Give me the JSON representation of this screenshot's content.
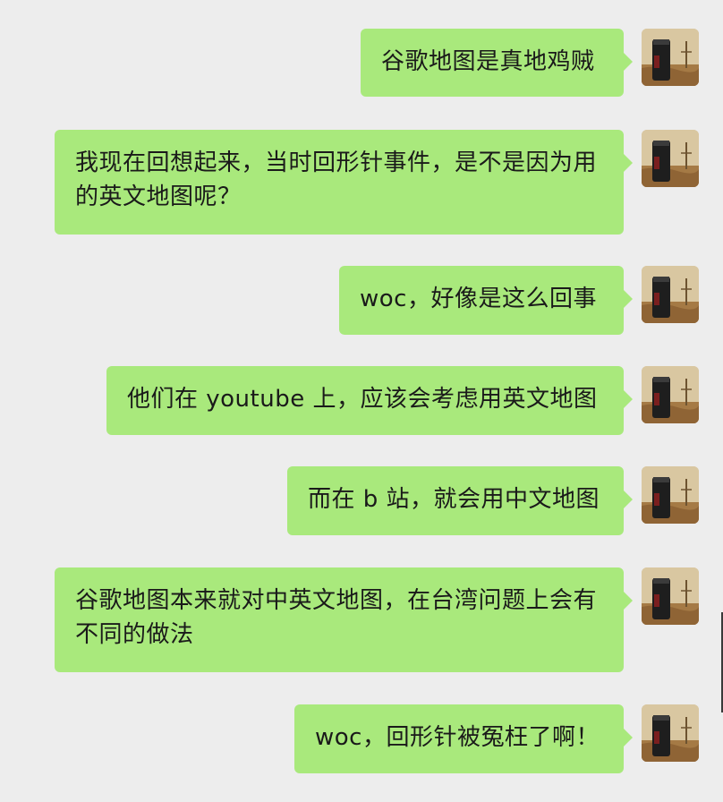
{
  "conversation": {
    "messages": [
      {
        "text": "谷歌地图是真地鸡贼"
      },
      {
        "text": "我现在回想起来，当时回形针事件，是不是因为用的英文地图呢？"
      },
      {
        "text": "woc，好像是这么回事"
      },
      {
        "text": "他们在 youtube 上，应该会考虑用英文地图"
      },
      {
        "text": "而在 b 站，就会用中文地图"
      },
      {
        "text": "谷歌地图本来就对中英文地图，在台湾问题上会有不同的做法"
      },
      {
        "text": "woc，回形针被冤枉了啊！"
      }
    ]
  },
  "colors": {
    "background": "#ededed",
    "bubble": "#a9e97c",
    "text": "#1a1a1a"
  },
  "icons": {
    "avatar": "user-avatar-icon"
  }
}
